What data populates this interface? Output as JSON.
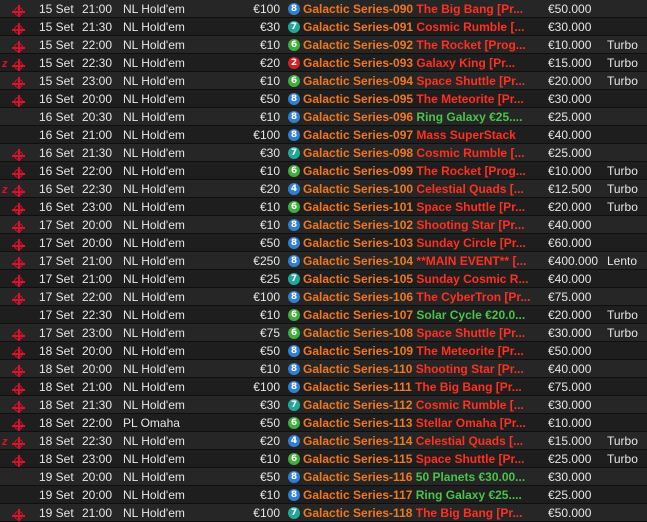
{
  "colors": {
    "badge_blue": "#2f7fd6",
    "badge_green": "#3fae3f",
    "badge_teal": "#22a89a",
    "badge_red": "#d42020",
    "series": "#f07820",
    "sub": "#ff3020",
    "green": "#49c34a"
  },
  "rows": [
    {
      "icon1": "",
      "icon2": "target",
      "date": "15 Set",
      "time": "21:00",
      "game": "NL Hold'em",
      "buyin": "€100",
      "badge": "8",
      "badge_color": "blue",
      "series": "Galactic Series-090",
      "sub": "The Big Bang [Pr...",
      "sub_green": false,
      "prize": "€50.000",
      "speed": ""
    },
    {
      "icon1": "",
      "icon2": "target",
      "date": "15 Set",
      "time": "21:30",
      "game": "NL Hold'em",
      "buyin": "€30",
      "badge": "7",
      "badge_color": "teal",
      "series": "Galactic Series-091",
      "sub": "Cosmic Rumble [...",
      "sub_green": false,
      "prize": "€30.000",
      "speed": ""
    },
    {
      "icon1": "",
      "icon2": "target",
      "date": "15 Set",
      "time": "22:00",
      "game": "NL Hold'em",
      "buyin": "€10",
      "badge": "6",
      "badge_color": "green",
      "series": "Galactic Series-092",
      "sub": "The Rocket [Prog...",
      "sub_green": false,
      "prize": "€10.000",
      "speed": "Turbo"
    },
    {
      "icon1": "z",
      "icon2": "target",
      "date": "15 Set",
      "time": "22:30",
      "game": "NL Hold'em",
      "buyin": "€20",
      "badge": "2",
      "badge_color": "red",
      "series": "Galactic Series-093",
      "sub": "Galaxy King [Pr...",
      "sub_green": false,
      "prize": "€15.000",
      "speed": "Turbo"
    },
    {
      "icon1": "",
      "icon2": "target",
      "date": "15 Set",
      "time": "23:00",
      "game": "NL Hold'em",
      "buyin": "€10",
      "badge": "6",
      "badge_color": "green",
      "series": "Galactic Series-094",
      "sub": "Space Shuttle [Pr...",
      "sub_green": false,
      "prize": "€20.000",
      "speed": "Turbo"
    },
    {
      "icon1": "",
      "icon2": "target",
      "date": "16 Set",
      "time": "20:00",
      "game": "NL Hold'em",
      "buyin": "€50",
      "badge": "8",
      "badge_color": "blue",
      "series": "Galactic Series-095",
      "sub": "The Meteorite [Pr...",
      "sub_green": false,
      "prize": "€30.000",
      "speed": ""
    },
    {
      "icon1": "",
      "icon2": "",
      "date": "16 Set",
      "time": "20:30",
      "game": "NL Hold'em",
      "buyin": "€10",
      "badge": "8",
      "badge_color": "blue",
      "series": "Galactic Series-096",
      "sub": "Ring Galaxy €25....",
      "sub_green": true,
      "prize": "€25.000",
      "speed": ""
    },
    {
      "icon1": "",
      "icon2": "",
      "date": "16 Set",
      "time": "21:00",
      "game": "NL Hold'em",
      "buyin": "€100",
      "badge": "8",
      "badge_color": "blue",
      "series": "Galactic Series-097",
      "sub": "Mass SuperStack",
      "sub_green": false,
      "prize": "€40.000",
      "speed": ""
    },
    {
      "icon1": "",
      "icon2": "target",
      "date": "16 Set",
      "time": "21:30",
      "game": "NL Hold'em",
      "buyin": "€30",
      "badge": "7",
      "badge_color": "teal",
      "series": "Galactic Series-098",
      "sub": "Cosmic Rumble [...",
      "sub_green": false,
      "prize": "€25.000",
      "speed": ""
    },
    {
      "icon1": "",
      "icon2": "target",
      "date": "16 Set",
      "time": "22:00",
      "game": "NL Hold'em",
      "buyin": "€10",
      "badge": "6",
      "badge_color": "green",
      "series": "Galactic Series-099",
      "sub": "The Rocket [Prog...",
      "sub_green": false,
      "prize": "€10.000",
      "speed": "Turbo"
    },
    {
      "icon1": "z",
      "icon2": "target",
      "date": "16 Set",
      "time": "22:30",
      "game": "NL Hold'em",
      "buyin": "€20",
      "badge": "4",
      "badge_color": "blue",
      "series": "Galactic Series-100",
      "sub": "Celestial Quads [...",
      "sub_green": false,
      "prize": "€12.500",
      "speed": "Turbo"
    },
    {
      "icon1": "",
      "icon2": "target",
      "date": "16 Set",
      "time": "23:00",
      "game": "NL Hold'em",
      "buyin": "€10",
      "badge": "6",
      "badge_color": "green",
      "series": "Galactic Series-101",
      "sub": "Space Shuttle [Pr...",
      "sub_green": false,
      "prize": "€20.000",
      "speed": "Turbo"
    },
    {
      "icon1": "",
      "icon2": "target",
      "date": "17 Set",
      "time": "20:00",
      "game": "NL Hold'em",
      "buyin": "€10",
      "badge": "8",
      "badge_color": "blue",
      "series": "Galactic Series-102",
      "sub": "Shooting Star [Pr...",
      "sub_green": false,
      "prize": "€40.000",
      "speed": ""
    },
    {
      "icon1": "",
      "icon2": "target",
      "date": "17 Set",
      "time": "20:00",
      "game": "NL Hold'em",
      "buyin": "€50",
      "badge": "8",
      "badge_color": "blue",
      "series": "Galactic Series-103",
      "sub": "Sunday Circle [Pr...",
      "sub_green": false,
      "prize": "€60.000",
      "speed": ""
    },
    {
      "icon1": "",
      "icon2": "target",
      "date": "17 Set",
      "time": "21:00",
      "game": "NL Hold'em",
      "buyin": "€250",
      "badge": "8",
      "badge_color": "blue",
      "series": "Galactic Series-104",
      "sub": "**MAIN EVENT** [...",
      "sub_green": false,
      "prize": "€400.000",
      "speed": "Lento"
    },
    {
      "icon1": "",
      "icon2": "target",
      "date": "17 Set",
      "time": "21:00",
      "game": "NL Hold'em",
      "buyin": "€25",
      "badge": "7",
      "badge_color": "teal",
      "series": "Galactic Series-105",
      "sub": "Sunday Cosmic R...",
      "sub_green": false,
      "prize": "€40.000",
      "speed": ""
    },
    {
      "icon1": "",
      "icon2": "target",
      "date": "17 Set",
      "time": "22:00",
      "game": "NL Hold'em",
      "buyin": "€100",
      "badge": "8",
      "badge_color": "blue",
      "series": "Galactic Series-106",
      "sub": "The CyberTron [Pr...",
      "sub_green": false,
      "prize": "€75.000",
      "speed": ""
    },
    {
      "icon1": "",
      "icon2": "",
      "date": "17 Set",
      "time": "22:30",
      "game": "NL Hold'em",
      "buyin": "€10",
      "badge": "6",
      "badge_color": "green",
      "series": "Galactic Series-107",
      "sub": "Solar Cycle €20.0...",
      "sub_green": true,
      "prize": "€20.000",
      "speed": "Turbo"
    },
    {
      "icon1": "",
      "icon2": "target",
      "date": "17 Set",
      "time": "23:00",
      "game": "NL Hold'em",
      "buyin": "€75",
      "badge": "6",
      "badge_color": "green",
      "series": "Galactic Series-108",
      "sub": "Space Shuttle [Pr...",
      "sub_green": false,
      "prize": "€30.000",
      "speed": "Turbo"
    },
    {
      "icon1": "",
      "icon2": "target",
      "date": "18 Set",
      "time": "20:00",
      "game": "NL Hold'em",
      "buyin": "€50",
      "badge": "8",
      "badge_color": "blue",
      "series": "Galactic Series-109",
      "sub": "The Meteorite [Pr...",
      "sub_green": false,
      "prize": "€50.000",
      "speed": ""
    },
    {
      "icon1": "",
      "icon2": "target",
      "date": "18 Set",
      "time": "20:00",
      "game": "NL Hold'em",
      "buyin": "€10",
      "badge": "8",
      "badge_color": "blue",
      "series": "Galactic Series-110",
      "sub": "Shooting Star [Pr...",
      "sub_green": false,
      "prize": "€40.000",
      "speed": ""
    },
    {
      "icon1": "",
      "icon2": "target",
      "date": "18 Set",
      "time": "21:00",
      "game": "NL Hold'em",
      "buyin": "€100",
      "badge": "8",
      "badge_color": "blue",
      "series": "Galactic Series-111",
      "sub": "The Big Bang [Pr...",
      "sub_green": false,
      "prize": "€75.000",
      "speed": ""
    },
    {
      "icon1": "",
      "icon2": "target",
      "date": "18 Set",
      "time": "21:30",
      "game": "NL Hold'em",
      "buyin": "€30",
      "badge": "7",
      "badge_color": "teal",
      "series": "Galactic Series-112",
      "sub": "Cosmic Rumble [...",
      "sub_green": false,
      "prize": "€30.000",
      "speed": ""
    },
    {
      "icon1": "",
      "icon2": "target",
      "date": "18 Set",
      "time": "22:00",
      "game": "PL Omaha",
      "buyin": "€50",
      "badge": "6",
      "badge_color": "green",
      "series": "Galactic Series-113",
      "sub": "Stellar Omaha [Pr...",
      "sub_green": false,
      "prize": "€10.000",
      "speed": ""
    },
    {
      "icon1": "z",
      "icon2": "target",
      "date": "18 Set",
      "time": "22:30",
      "game": "NL Hold'em",
      "buyin": "€20",
      "badge": "4",
      "badge_color": "blue",
      "series": "Galactic Series-114",
      "sub": "Celestial Quads [...",
      "sub_green": false,
      "prize": "€15.000",
      "speed": "Turbo"
    },
    {
      "icon1": "",
      "icon2": "target",
      "date": "18 Set",
      "time": "23:00",
      "game": "NL Hold'em",
      "buyin": "€10",
      "badge": "6",
      "badge_color": "green",
      "series": "Galactic Series-115",
      "sub": "Space Shuttle [Pr...",
      "sub_green": false,
      "prize": "€25.000",
      "speed": "Turbo"
    },
    {
      "icon1": "",
      "icon2": "",
      "date": "19 Set",
      "time": "20:00",
      "game": "NL Hold'em",
      "buyin": "€50",
      "badge": "8",
      "badge_color": "blue",
      "series": "Galactic Series-116",
      "sub": "50 Planets €30.00...",
      "sub_green": true,
      "prize": "€30.000",
      "speed": ""
    },
    {
      "icon1": "",
      "icon2": "",
      "date": "19 Set",
      "time": "20:00",
      "game": "NL Hold'em",
      "buyin": "€10",
      "badge": "8",
      "badge_color": "blue",
      "series": "Galactic Series-117",
      "sub": "Ring Galaxy €25....",
      "sub_green": true,
      "prize": "€25.000",
      "speed": ""
    },
    {
      "icon1": "",
      "icon2": "target",
      "date": "19 Set",
      "time": "21:00",
      "game": "NL Hold'em",
      "buyin": "€100",
      "badge": "7",
      "badge_color": "teal",
      "series": "Galactic Series-118",
      "sub": "The Big Bang [Pr...",
      "sub_green": false,
      "prize": "€50.000",
      "speed": ""
    }
  ]
}
